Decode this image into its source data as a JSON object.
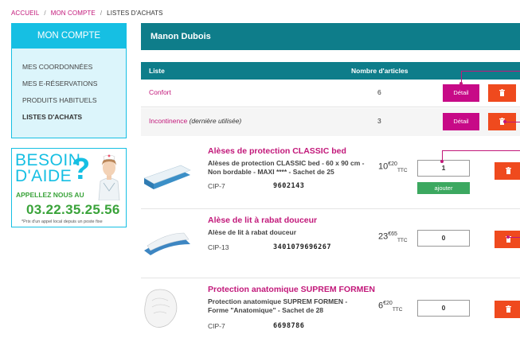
{
  "breadcrumb": {
    "home": "ACCUEIL",
    "account": "MON COMPTE",
    "current": "LISTES D'ACHATS"
  },
  "sidebar": {
    "title": "MON COMPTE",
    "items": [
      {
        "label": "MES COORDONNÉES",
        "active": false
      },
      {
        "label": "MES E-RÉSERVATIONS",
        "active": false
      },
      {
        "label": "PRODUITS HABITUELS",
        "active": false
      },
      {
        "label": "LISTES D'ACHATS",
        "active": true
      }
    ]
  },
  "help": {
    "line1": "BESOIN",
    "line2": "D'AIDE",
    "qmark": "?",
    "call": "APPELLEZ NOUS AU",
    "phone": "03.22.35.25.56",
    "note": "*Prix d'un appel local depuis un poste fixe"
  },
  "user": {
    "name": "Manon Dubois"
  },
  "lists": {
    "header_name": "Liste",
    "header_count": "Nombre d'articles",
    "detail_label": "Détail",
    "rows": [
      {
        "name": "Confort",
        "note": "",
        "count": "6"
      },
      {
        "name": "Incontinence",
        "note": "(dernière utilisée)",
        "count": "3"
      }
    ]
  },
  "products": [
    {
      "title": "Alèses de protection CLASSIC bed",
      "desc": "Alèses de protection CLASSIC bed - 60 x 90 cm - Non bordable - MAXI **** - Sachet de 25",
      "cip_label": "CIP-7",
      "cip": "9602143",
      "price_int": "10",
      "price_dec": "€20",
      "price_tax": "TTC",
      "qty": "1",
      "add_label": "ajouter"
    },
    {
      "title": "Alèse de lit à rabat douceur",
      "desc": "Alèse de lit à rabat douceur",
      "cip_label": "CIP-13",
      "cip": "3401079696267",
      "price_int": "23",
      "price_dec": "€65",
      "price_tax": "TTC",
      "qty": "0"
    },
    {
      "title": "Protection anatomique SUPREM FORMEN",
      "desc": "Protection anatomique SUPREM FORMEN - Forme \"Anatomique\" - Sachet de 28",
      "cip_label": "CIP-7",
      "cip": "6698786",
      "price_int": "6",
      "price_dec": "€20",
      "price_tax": "TTC",
      "qty": "0"
    }
  ],
  "colors": {
    "accent_magenta": "#c2187a",
    "sidebar_cyan": "#16bfe3",
    "header_teal": "#0e7d8a",
    "delete_orange": "#ef4a1e",
    "add_green": "#3ca860",
    "help_green": "#3aa33a"
  },
  "icons": {
    "delete": "trash-icon"
  }
}
